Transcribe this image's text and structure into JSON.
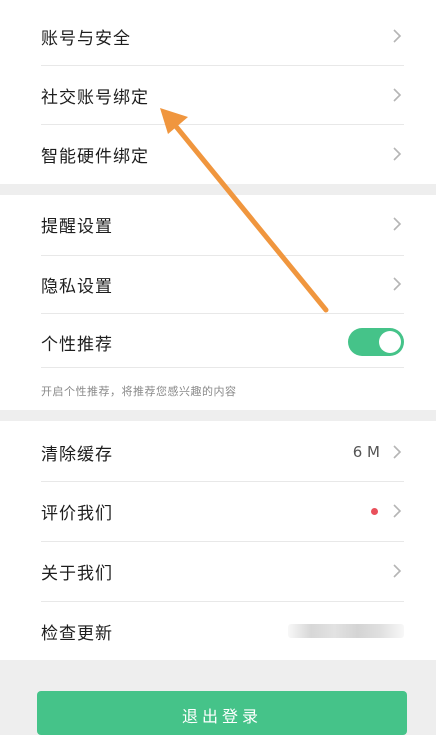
{
  "group1": {
    "items": [
      {
        "label": "账号与安全"
      },
      {
        "label": "社交账号绑定"
      },
      {
        "label": "智能硬件绑定"
      }
    ]
  },
  "group2": {
    "items": [
      {
        "label": "提醒设置"
      },
      {
        "label": "隐私设置"
      },
      {
        "label": "个性推荐",
        "toggle_on": true
      }
    ],
    "hint": "开启个性推荐，将推荐您感兴趣的内容"
  },
  "group3": {
    "items": [
      {
        "label": "清除缓存",
        "value": "6 M"
      },
      {
        "label": "评价我们",
        "badge": "red-dot"
      },
      {
        "label": "关于我们"
      },
      {
        "label": "检查更新"
      }
    ]
  },
  "logout": {
    "label": "退出登录"
  },
  "colors": {
    "accent": "#45c389",
    "dot": "#e9505b",
    "annotation_arrow": "#f0963e"
  }
}
